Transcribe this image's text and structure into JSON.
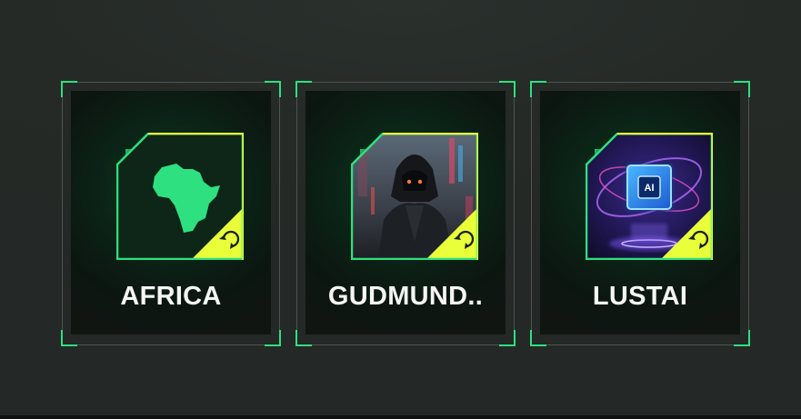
{
  "cards": [
    {
      "name": "AFRICA",
      "image": "africa-map-icon",
      "badge_icon": "refresh-icon"
    },
    {
      "name": "GUDMUND..",
      "image": "hooded-cyberpunk-figure",
      "badge_icon": "refresh-icon"
    },
    {
      "name": "LUSTAI",
      "image": "ai-chip-portal",
      "badge_icon": "refresh-icon"
    }
  ],
  "colors": {
    "accent_green": "#2ee07f",
    "badge_yellow": "#e8ff3a",
    "background": "#252a27"
  }
}
